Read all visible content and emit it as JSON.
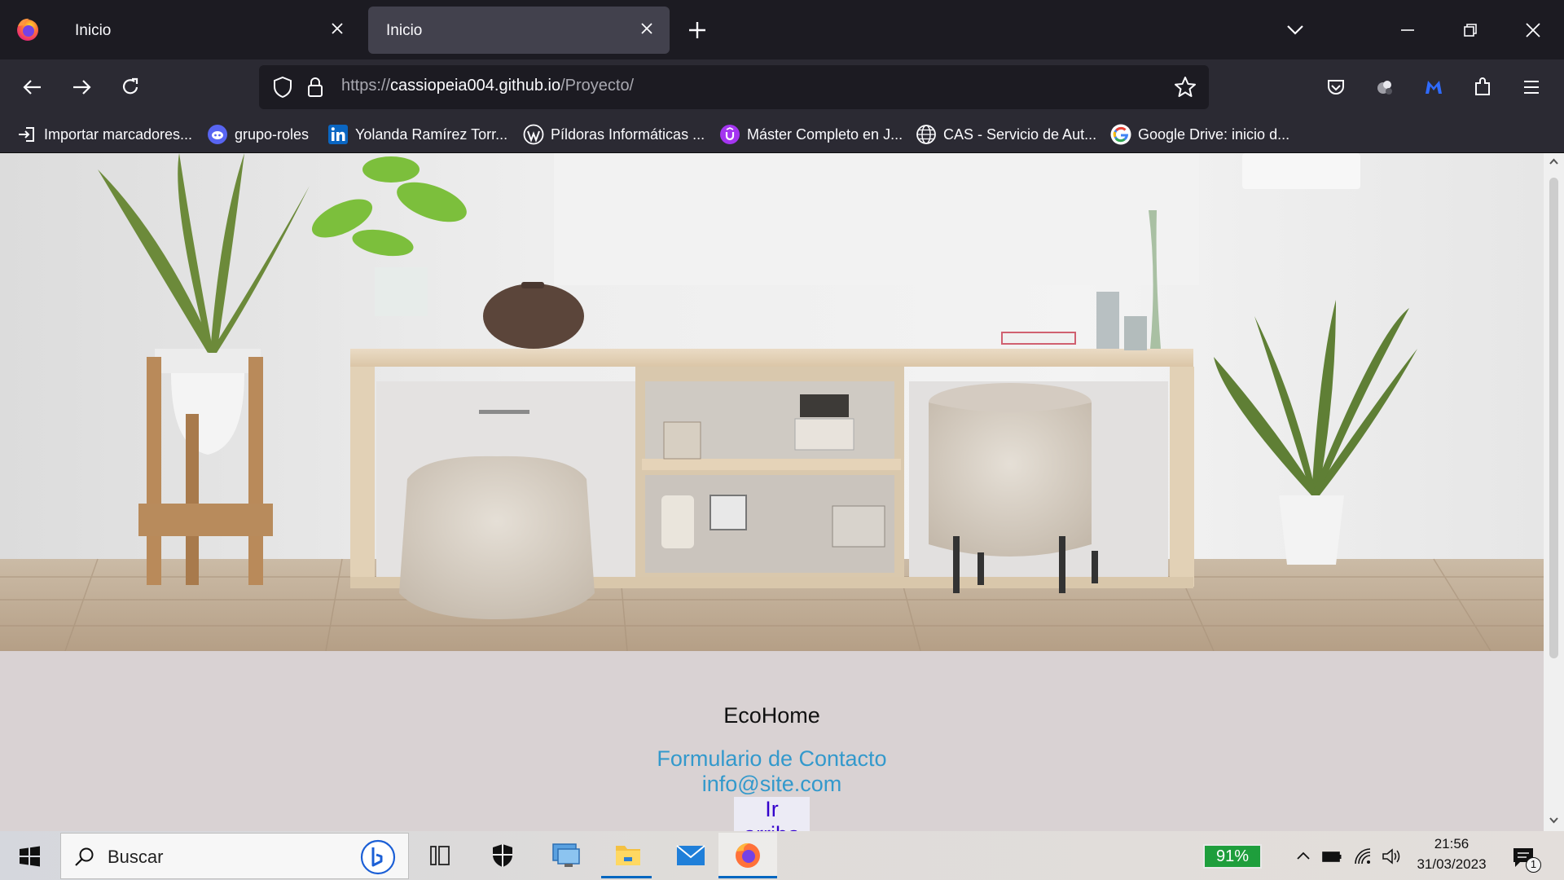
{
  "browser": {
    "tabs": [
      {
        "label": "Inicio",
        "active": false
      },
      {
        "label": "Inicio",
        "active": true
      }
    ],
    "url": {
      "scheme": "https://",
      "host": "cassiopeia004.github.io",
      "path": "/Proyecto/"
    },
    "bookmarks": [
      {
        "label": "Importar marcadores...",
        "icon": "import-icon"
      },
      {
        "label": "grupo-roles",
        "icon": "discord-icon"
      },
      {
        "label": "Yolanda Ramírez Torr...",
        "icon": "linkedin-icon"
      },
      {
        "label": "Píldoras Informáticas ...",
        "icon": "wordpress-icon"
      },
      {
        "label": "Máster Completo en J...",
        "icon": "udemy-icon"
      },
      {
        "label": "CAS - Servicio de Aut...",
        "icon": "globe-icon"
      },
      {
        "label": "Google Drive: inicio d...",
        "icon": "google-icon"
      }
    ]
  },
  "page": {
    "hero_image": "living-room-with-wooden-sideboard-plants-and-poufs",
    "footer": {
      "brand": "EcoHome",
      "contact_link": "Formulario de Contacto",
      "email_link": "info@site.com",
      "top_link": "Ir arriba"
    }
  },
  "taskbar": {
    "search_placeholder": "Buscar",
    "battery": "91%",
    "time": "21:56",
    "date": "31/03/2023",
    "notification_count": "1"
  },
  "colors": {
    "titlebar": "#1c1b22",
    "toolbar": "#2b2a33",
    "footer_bg": "#d9d2d3",
    "link": "#3399cc",
    "visited_link": "#3300cc",
    "battery_green": "#1e9e3c"
  }
}
